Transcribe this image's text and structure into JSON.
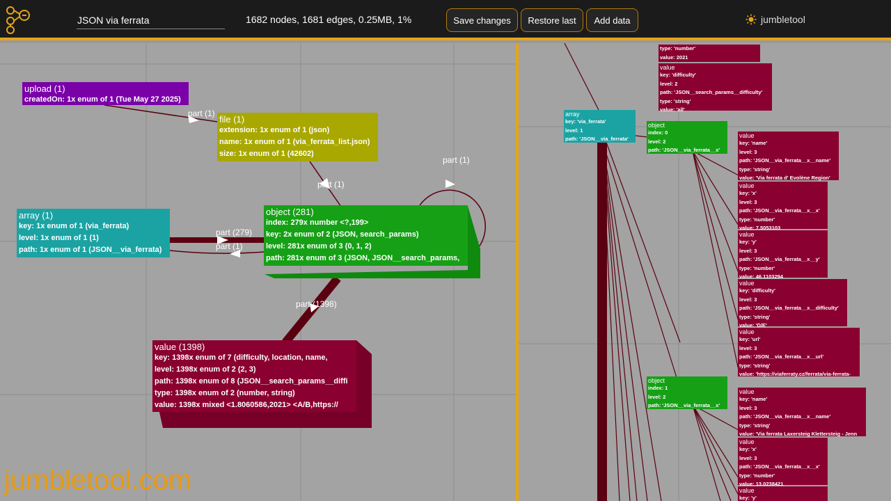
{
  "app": {
    "title_value": "JSON via ferrata",
    "stats": "1682 nodes, 1681 edges, 0.25MB, 1%",
    "save_label": "Save changes",
    "restore_label": "Restore last",
    "add_label": "Add data",
    "brand": "jumbletool",
    "watermark": "jumbletool.com",
    "accent": "#e8a317"
  },
  "left": {
    "upload": {
      "head": "upload (1)",
      "rows": [
        "createdOn:  1x enum of 1 (Tue May 27 2025)"
      ]
    },
    "file": {
      "head": "file (1)",
      "rows": [
        "extension:  1x enum of 1 (json)",
        "name:  1x enum of 1 (via_ferrata_list.json)",
        "size:  1x enum of 1 (42602)"
      ]
    },
    "array": {
      "head": "array (1)",
      "rows": [
        "key:  1x enum of 1 (via_ferrata)",
        "level:  1x enum of 1 (1)",
        "path:  1x enum of 1 (JSON__via_ferrata)"
      ]
    },
    "object": {
      "head": "object (281)",
      "rows": [
        "index:  279x number <?,199>",
        "key:  2x enum of 2 (JSON, search_params)",
        "level:  281x enum of 3 (0, 1, 2)",
        "path:  281x enum of 3 (JSON, JSON__search_params,"
      ]
    },
    "value": {
      "head": "value (1398)",
      "rows": [
        "key:  1398x enum of 7 (difficulty, location, name,",
        "level:  1398x enum of 2 (2, 3)",
        "path:  1398x enum of 8 (JSON__search_params__diffi",
        "type:  1398x enum of 2 (number, string)",
        "value:  1398x mixed <1.8060586,2021> <A/B,https://"
      ]
    },
    "edges": {
      "upload_file": "part (1)",
      "file_object": "part (1)",
      "object_self": "part (1)",
      "array_object": "part (279)",
      "object_array": "part (1)",
      "object_value": "part (1398)"
    }
  },
  "right": {
    "v_top": {
      "rows": [
        "type: 'number'",
        "value: 2021"
      ]
    },
    "v_diff": {
      "head": "value",
      "rows": [
        "key: 'difficulty'",
        "level: 2",
        "path: 'JSON__search_params__difficulty'",
        "type: 'string'",
        "value: 'all'"
      ]
    },
    "arr": {
      "head": "array",
      "rows": [
        "key: 'via_ferrata'",
        "level: 1",
        "path: 'JSON__via_ferrata'"
      ]
    },
    "obj0": {
      "head": "object",
      "rows": [
        "index: 0",
        "level: 2",
        "path: 'JSON__via_ferrata__x'"
      ]
    },
    "obj1": {
      "head": "object",
      "rows": [
        "index: 1",
        "level: 2",
        "path: 'JSON__via_ferrata__x'"
      ]
    },
    "v_name": {
      "head": "value",
      "rows": [
        "key: 'name'",
        "level: 3",
        "path: 'JSON__via_ferrata__x__name'",
        "type: 'string'",
        "value: 'Via ferrata d' Evolène Region'"
      ]
    },
    "v_x": {
      "head": "value",
      "rows": [
        "key: 'x'",
        "level: 3",
        "path: 'JSON__via_ferrata__x__x'",
        "type: 'number'",
        "value: 7.5053103"
      ]
    },
    "v_y": {
      "head": "value",
      "rows": [
        "key: 'y'",
        "level: 3",
        "path: 'JSON__via_ferrata__x__y'",
        "type: 'number'",
        "value: 46.1103294"
      ]
    },
    "v_difficulty": {
      "head": "value",
      "rows": [
        "key: 'difficulty'",
        "level: 3",
        "path: 'JSON__via_ferrata__x__difficulty'",
        "type: 'string'",
        "value: 'D/E'"
      ]
    },
    "v_url": {
      "head": "value",
      "rows": [
        "key: 'url'",
        "level: 3",
        "path: 'JSON__via_ferrata__x__url'",
        "type: 'string'",
        "value: 'https://viaferraty.cz/ferrata/via-ferrata-"
      ]
    },
    "v_name2": {
      "head": "value",
      "rows": [
        "key: 'name'",
        "level: 3",
        "path: 'JSON__via_ferrata__x__name'",
        "type: 'string'",
        "value: 'Via ferrata Laxersteig Klettersteig - Jenn"
      ]
    },
    "v_x2": {
      "head": "value",
      "rows": [
        "key: 'x'",
        "level: 3",
        "path: 'JSON__via_ferrata__x__x'",
        "type: 'number'",
        "value: 13.0238421"
      ]
    },
    "v_y2": {
      "head": "value",
      "rows": [
        "key: 'y'"
      ]
    }
  }
}
